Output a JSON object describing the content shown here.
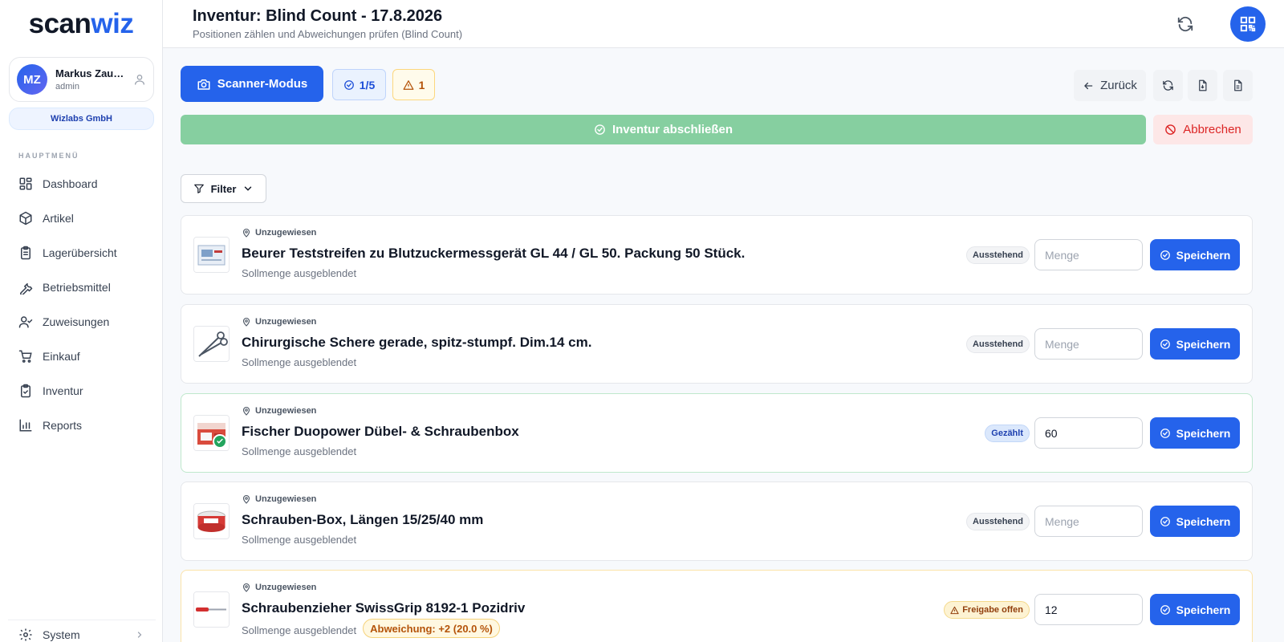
{
  "app": {
    "logo_part1": "scan",
    "logo_part2": "wiz"
  },
  "user": {
    "initials": "MZ",
    "name": "Markus Zau…",
    "role": "admin",
    "company": "Wizlabs GmbH"
  },
  "sidebar": {
    "section_title": "HAUPTMENÜ",
    "items": [
      {
        "label": "Dashboard",
        "icon": "dashboard-icon"
      },
      {
        "label": "Artikel",
        "icon": "box-icon"
      },
      {
        "label": "Lagerübersicht",
        "icon": "clipboard-list-icon"
      },
      {
        "label": "Betriebsmittel",
        "icon": "wrench-icon"
      },
      {
        "label": "Zuweisungen",
        "icon": "user-check-icon"
      },
      {
        "label": "Einkauf",
        "icon": "cart-icon"
      },
      {
        "label": "Inventur",
        "icon": "clipboard-check-icon"
      },
      {
        "label": "Reports",
        "icon": "bar-chart-icon"
      }
    ],
    "system_label": "System"
  },
  "header": {
    "title": "Inventur: Blind Count - 17.8.2026",
    "subtitle": "Positionen zählen und Abweichungen prüfen (Blind Count)"
  },
  "toolbar": {
    "scanner_label": "Scanner-Modus",
    "progress": "1/5",
    "warnings": "1",
    "back_label": "Zurück",
    "finish_label": "Inventur abschließen",
    "cancel_label": "Abbrechen",
    "filter_label": "Filter"
  },
  "colors": {
    "primary": "#2563eb",
    "success": "#86cfa0",
    "danger": "#dc2626",
    "warning": "#b45309"
  },
  "items": [
    {
      "location": "Unzugewiesen",
      "name": "Beurer Teststreifen zu Blutzuckermessgerät GL 44 / GL 50. Packung 50 Stück.",
      "sub": "Sollmenge ausgeblendet",
      "status": "Ausstehend",
      "quantity": "",
      "placeholder": "Menge",
      "save_label": "Speichern"
    },
    {
      "location": "Unzugewiesen",
      "name": "Chirurgische Schere gerade, spitz-stumpf. Dim.14 cm.",
      "sub": "Sollmenge ausgeblendet",
      "status": "Ausstehend",
      "quantity": "",
      "placeholder": "Menge",
      "save_label": "Speichern"
    },
    {
      "location": "Unzugewiesen",
      "name": "Fischer Duopower Dübel- & Schraubenbox",
      "sub": "Sollmenge ausgeblendet",
      "status": "Gezählt",
      "quantity": "60",
      "placeholder": "Menge",
      "save_label": "Speichern"
    },
    {
      "location": "Unzugewiesen",
      "name": "Schrauben-Box, Längen 15/25/40 mm",
      "sub": "Sollmenge ausgeblendet",
      "status": "Ausstehend",
      "quantity": "",
      "placeholder": "Menge",
      "save_label": "Speichern"
    },
    {
      "location": "Unzugewiesen",
      "name": "Schraubenzieher SwissGrip 8192-1 Pozidriv",
      "sub": "Sollmenge ausgeblendet",
      "deviation": "Abweichung: +2 (20.0 %)",
      "status": "Freigabe offen",
      "quantity": "12",
      "placeholder": "Menge",
      "save_label": "Speichern"
    }
  ]
}
